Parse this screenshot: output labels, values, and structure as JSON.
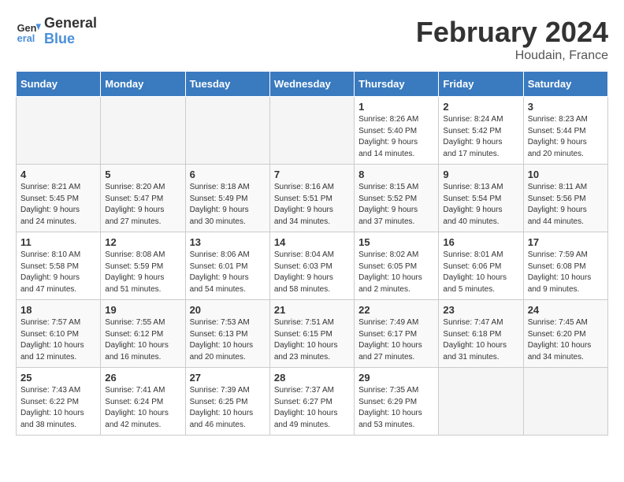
{
  "header": {
    "logo_general": "General",
    "logo_blue": "Blue",
    "month": "February 2024",
    "location": "Houdain, France"
  },
  "weekdays": [
    "Sunday",
    "Monday",
    "Tuesday",
    "Wednesday",
    "Thursday",
    "Friday",
    "Saturday"
  ],
  "weeks": [
    [
      {
        "day": "",
        "info": ""
      },
      {
        "day": "",
        "info": ""
      },
      {
        "day": "",
        "info": ""
      },
      {
        "day": "",
        "info": ""
      },
      {
        "day": "1",
        "info": "Sunrise: 8:26 AM\nSunset: 5:40 PM\nDaylight: 9 hours\nand 14 minutes."
      },
      {
        "day": "2",
        "info": "Sunrise: 8:24 AM\nSunset: 5:42 PM\nDaylight: 9 hours\nand 17 minutes."
      },
      {
        "day": "3",
        "info": "Sunrise: 8:23 AM\nSunset: 5:44 PM\nDaylight: 9 hours\nand 20 minutes."
      }
    ],
    [
      {
        "day": "4",
        "info": "Sunrise: 8:21 AM\nSunset: 5:45 PM\nDaylight: 9 hours\nand 24 minutes."
      },
      {
        "day": "5",
        "info": "Sunrise: 8:20 AM\nSunset: 5:47 PM\nDaylight: 9 hours\nand 27 minutes."
      },
      {
        "day": "6",
        "info": "Sunrise: 8:18 AM\nSunset: 5:49 PM\nDaylight: 9 hours\nand 30 minutes."
      },
      {
        "day": "7",
        "info": "Sunrise: 8:16 AM\nSunset: 5:51 PM\nDaylight: 9 hours\nand 34 minutes."
      },
      {
        "day": "8",
        "info": "Sunrise: 8:15 AM\nSunset: 5:52 PM\nDaylight: 9 hours\nand 37 minutes."
      },
      {
        "day": "9",
        "info": "Sunrise: 8:13 AM\nSunset: 5:54 PM\nDaylight: 9 hours\nand 40 minutes."
      },
      {
        "day": "10",
        "info": "Sunrise: 8:11 AM\nSunset: 5:56 PM\nDaylight: 9 hours\nand 44 minutes."
      }
    ],
    [
      {
        "day": "11",
        "info": "Sunrise: 8:10 AM\nSunset: 5:58 PM\nDaylight: 9 hours\nand 47 minutes."
      },
      {
        "day": "12",
        "info": "Sunrise: 8:08 AM\nSunset: 5:59 PM\nDaylight: 9 hours\nand 51 minutes."
      },
      {
        "day": "13",
        "info": "Sunrise: 8:06 AM\nSunset: 6:01 PM\nDaylight: 9 hours\nand 54 minutes."
      },
      {
        "day": "14",
        "info": "Sunrise: 8:04 AM\nSunset: 6:03 PM\nDaylight: 9 hours\nand 58 minutes."
      },
      {
        "day": "15",
        "info": "Sunrise: 8:02 AM\nSunset: 6:05 PM\nDaylight: 10 hours\nand 2 minutes."
      },
      {
        "day": "16",
        "info": "Sunrise: 8:01 AM\nSunset: 6:06 PM\nDaylight: 10 hours\nand 5 minutes."
      },
      {
        "day": "17",
        "info": "Sunrise: 7:59 AM\nSunset: 6:08 PM\nDaylight: 10 hours\nand 9 minutes."
      }
    ],
    [
      {
        "day": "18",
        "info": "Sunrise: 7:57 AM\nSunset: 6:10 PM\nDaylight: 10 hours\nand 12 minutes."
      },
      {
        "day": "19",
        "info": "Sunrise: 7:55 AM\nSunset: 6:12 PM\nDaylight: 10 hours\nand 16 minutes."
      },
      {
        "day": "20",
        "info": "Sunrise: 7:53 AM\nSunset: 6:13 PM\nDaylight: 10 hours\nand 20 minutes."
      },
      {
        "day": "21",
        "info": "Sunrise: 7:51 AM\nSunset: 6:15 PM\nDaylight: 10 hours\nand 23 minutes."
      },
      {
        "day": "22",
        "info": "Sunrise: 7:49 AM\nSunset: 6:17 PM\nDaylight: 10 hours\nand 27 minutes."
      },
      {
        "day": "23",
        "info": "Sunrise: 7:47 AM\nSunset: 6:18 PM\nDaylight: 10 hours\nand 31 minutes."
      },
      {
        "day": "24",
        "info": "Sunrise: 7:45 AM\nSunset: 6:20 PM\nDaylight: 10 hours\nand 34 minutes."
      }
    ],
    [
      {
        "day": "25",
        "info": "Sunrise: 7:43 AM\nSunset: 6:22 PM\nDaylight: 10 hours\nand 38 minutes."
      },
      {
        "day": "26",
        "info": "Sunrise: 7:41 AM\nSunset: 6:24 PM\nDaylight: 10 hours\nand 42 minutes."
      },
      {
        "day": "27",
        "info": "Sunrise: 7:39 AM\nSunset: 6:25 PM\nDaylight: 10 hours\nand 46 minutes."
      },
      {
        "day": "28",
        "info": "Sunrise: 7:37 AM\nSunset: 6:27 PM\nDaylight: 10 hours\nand 49 minutes."
      },
      {
        "day": "29",
        "info": "Sunrise: 7:35 AM\nSunset: 6:29 PM\nDaylight: 10 hours\nand 53 minutes."
      },
      {
        "day": "",
        "info": ""
      },
      {
        "day": "",
        "info": ""
      }
    ]
  ]
}
